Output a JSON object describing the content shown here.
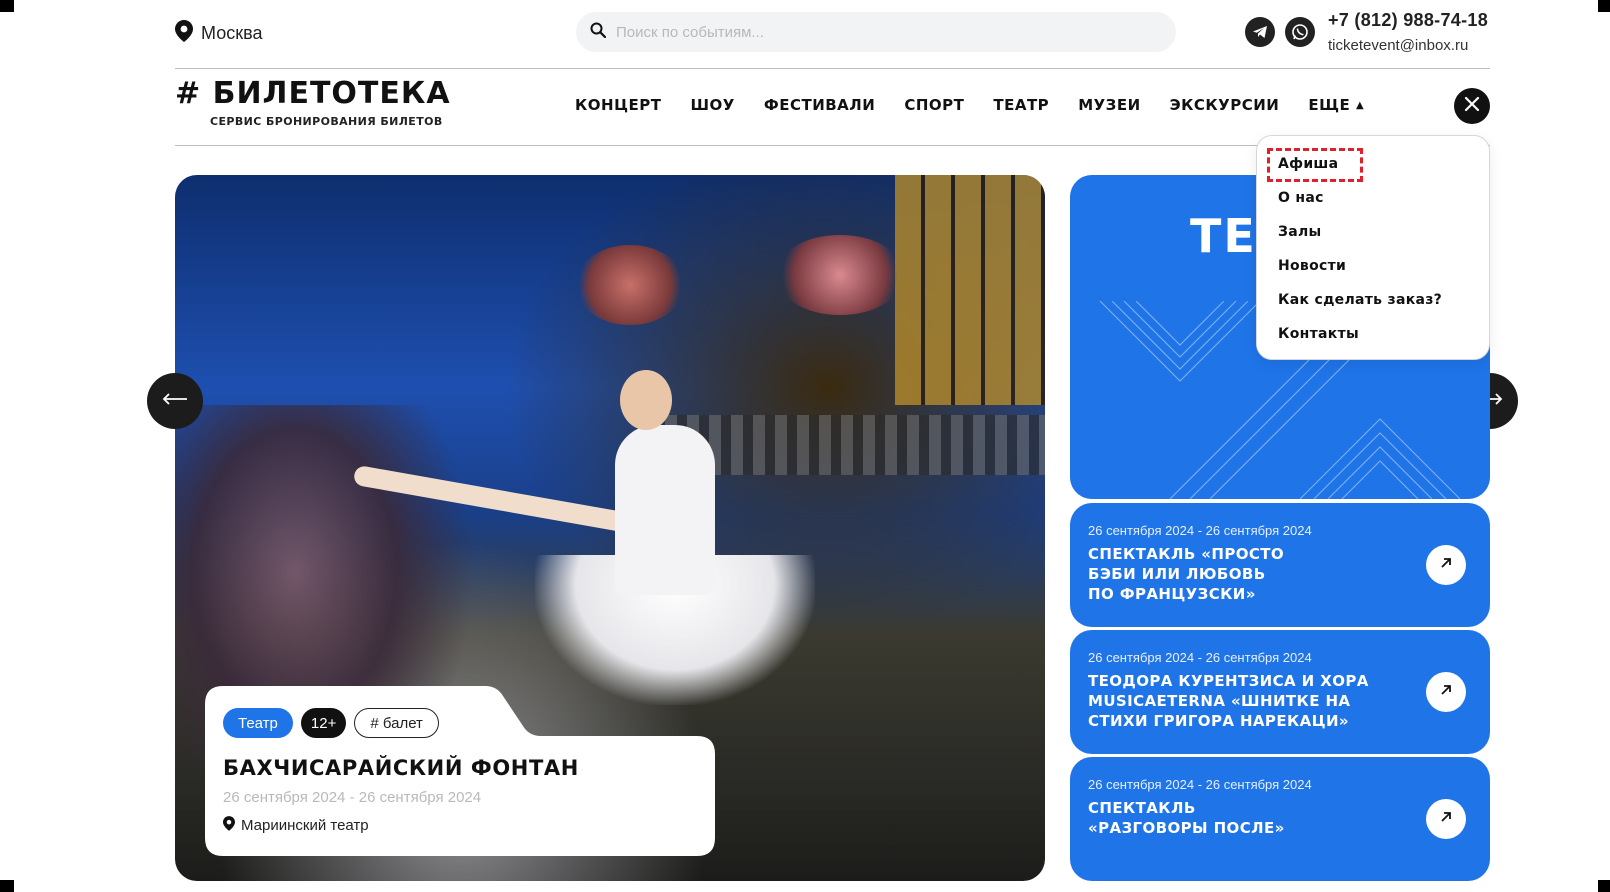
{
  "topbar": {
    "city": "Москва",
    "search_placeholder": "Поиск по событиям...",
    "phone": "+7 (812) 988-74-18",
    "email": "ticketevent@inbox.ru",
    "social_icons": [
      "telegram-icon",
      "whatsapp-icon"
    ]
  },
  "logo": {
    "main": "# БИЛЕТОТЕКА",
    "sub": "СЕРВИС БРОНИРОВАНИЯ БИЛЕТОВ"
  },
  "nav": {
    "items": [
      "КОНЦЕРТ",
      "ШОУ",
      "ФЕСТИВАЛИ",
      "СПОРТ",
      "ТЕАТР",
      "МУЗЕИ",
      "ЭКСКУРСИИ"
    ],
    "more_label": "ЕЩЕ",
    "more_arrow": "▲"
  },
  "dropdown": {
    "items": [
      "Афиша",
      "О нас",
      "Залы",
      "Новости",
      "Как сделать заказ?",
      "Контакты"
    ]
  },
  "hero": {
    "tags": [
      "Театр",
      "12+",
      "# балет"
    ],
    "title": "БАХЧИСАРАЙСКИЙ ФОНТАН",
    "dates": "26 сентября 2024 - 26 сентября 2024",
    "venue": "Мариинский театр"
  },
  "side": {
    "big_text": "ТЕ",
    "events": [
      {
        "date": "26 сентября 2024 - 26 сентября 2024",
        "title": "СПЕКТАКЛЬ «ПРОСТО\nБЭБИ ИЛИ ЛЮБОВЬ\nПО ФРАНЦУЗСКИ»"
      },
      {
        "date": "26 сентября 2024 - 26 сентября 2024",
        "title": "ТЕОДОРА КУРЕНТЗИСА И ХОРА\nMUSICAETERNA «ШНИТКЕ НА\nСТИХИ ГРИГОРА НАРЕКАЦИ»"
      },
      {
        "date": "26 сентября 2024 - 26 сентября 2024",
        "title": "СПЕКТАКЛЬ\n«РАЗГОВОРЫ ПОСЛЕ»"
      }
    ]
  },
  "colors": {
    "accent": "#1f74e8",
    "dark": "#111111",
    "focus": "#e0202c"
  }
}
